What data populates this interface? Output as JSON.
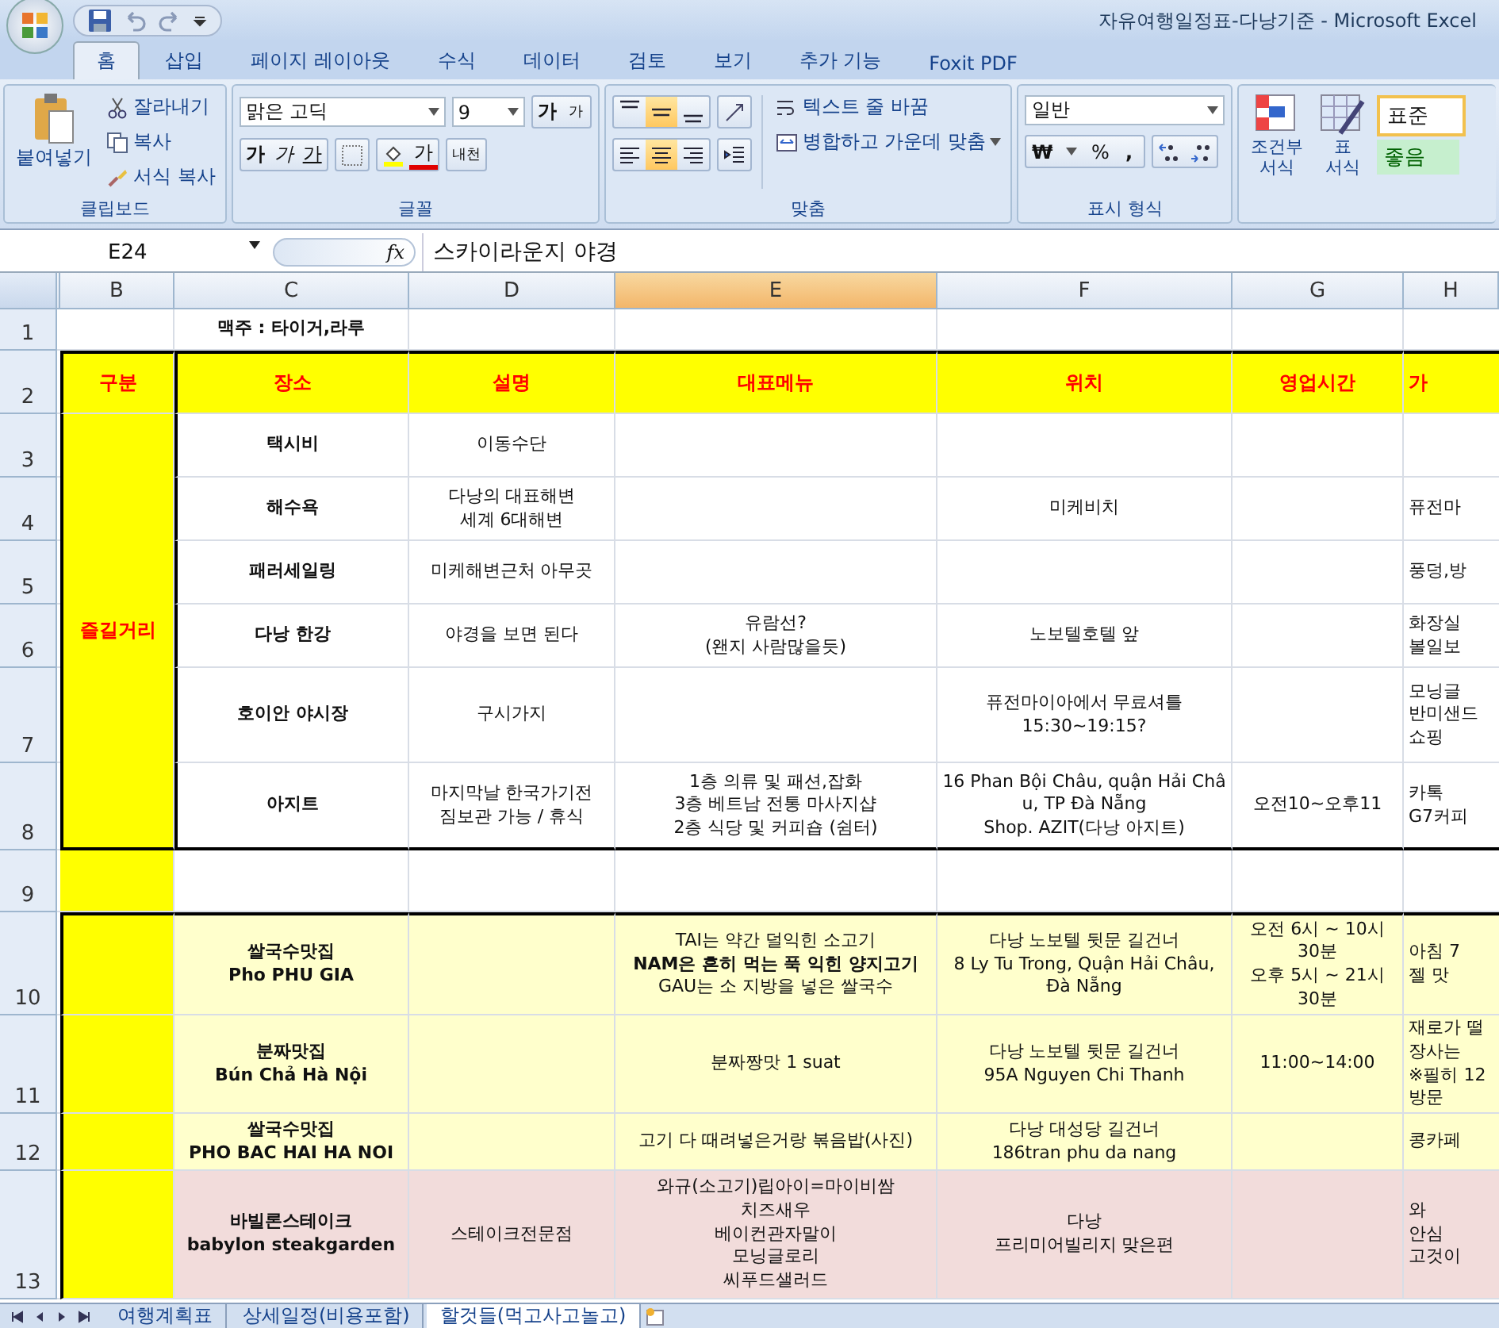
{
  "window": {
    "title": "자유여행일정표-다낭기준 - Microsoft Excel"
  },
  "tabs": [
    {
      "label": "홈",
      "selected": true
    },
    {
      "label": "삽입",
      "selected": false
    },
    {
      "label": "페이지 레이아웃",
      "selected": false
    },
    {
      "label": "수식",
      "selected": false
    },
    {
      "label": "데이터",
      "selected": false
    },
    {
      "label": "검토",
      "selected": false
    },
    {
      "label": "보기",
      "selected": false
    },
    {
      "label": "추가 기능",
      "selected": false
    },
    {
      "label": "Foxit PDF",
      "selected": false
    }
  ],
  "clipboard": {
    "paste": "붙여넣기",
    "cut": "잘라내기",
    "copy": "복사",
    "format_painter": "서식 복사",
    "label": "클립보드"
  },
  "font": {
    "name": "맑은 고딕",
    "size": "9",
    "grow": "가",
    "shrink": "가",
    "bold": "가",
    "italic": "가",
    "underline": "가",
    "font_color": "가",
    "phonetic": "내천",
    "label": "글꼴"
  },
  "alignment": {
    "vertical": [
      {
        "kind": "top",
        "selected": false
      },
      {
        "kind": "middle",
        "selected": true
      },
      {
        "kind": "bottom",
        "selected": false
      }
    ],
    "horizontal": [
      {
        "kind": "left",
        "selected": false
      },
      {
        "kind": "center",
        "selected": true
      },
      {
        "kind": "right",
        "selected": false
      }
    ],
    "wrap": "텍스트 줄 바꿈",
    "merge": "병합하고 가운데 맞춤",
    "label": "맞춤"
  },
  "number": {
    "format": "일반",
    "currency": "₩",
    "percent": "%",
    "comma": ",",
    "label": "표시 형식"
  },
  "styles": {
    "conditional": "조건부\n서식",
    "table": "표\n서식",
    "normal": "표준",
    "good": "좋음"
  },
  "formula_bar": {
    "name_box": "E24",
    "function_label": "fx",
    "formula": "스카이라운지 야경"
  },
  "columns": [
    {
      "label": "B",
      "selected": false
    },
    {
      "label": "C",
      "selected": false
    },
    {
      "label": "D",
      "selected": false
    },
    {
      "label": "E",
      "selected": true
    },
    {
      "label": "F",
      "selected": false
    },
    {
      "label": "G",
      "selected": false
    },
    {
      "label": "H",
      "selected": false
    }
  ],
  "category": "즐길거리",
  "rows": [
    {
      "number": "1",
      "kind": "plain",
      "cells": [
        "",
        "맥주 : 타이거,라루",
        "",
        "",
        "",
        "",
        ""
      ]
    },
    {
      "number": "2",
      "kind": "header",
      "cells": [
        "구분",
        "장소",
        "설명",
        "대표메뉴",
        "위치",
        "영업시간",
        "가"
      ]
    },
    {
      "number": "3",
      "kind": "item",
      "cells": [
        "",
        "택시비",
        "이동수단",
        "",
        "",
        "",
        ""
      ]
    },
    {
      "number": "4",
      "kind": "item",
      "cells": [
        "",
        "해수욕",
        "다낭의 대표해변\n세계 6대해변",
        "",
        "미케비치",
        "",
        "퓨전마"
      ]
    },
    {
      "number": "5",
      "kind": "item",
      "cells": [
        "",
        "패러세일링",
        "미케해변근처 아무곳",
        "",
        "",
        "",
        "풍덩,방"
      ]
    },
    {
      "number": "6",
      "kind": "item",
      "cells": [
        "",
        "다낭 한강",
        "야경을 보면 된다",
        "유람선?\n(왠지 사람많을듯)",
        "노보텔호텔 앞",
        "",
        "화장실\n볼일보"
      ]
    },
    {
      "number": "7",
      "kind": "item",
      "cells": [
        "",
        "호이안 야시장",
        "구시가지",
        "",
        "퓨전마이아에서 무료셔틀\n15:30~19:15?",
        "",
        "모닝글\n반미샌드\n쇼핑"
      ]
    },
    {
      "number": "8",
      "kind": "item",
      "cells": [
        "",
        "아지트",
        "마지막날 한국가기전\n짐보관 가능 / 휴식",
        "1층 의류 및 패션,잡화\n3층 베트남 전통 마사지샵\n2층 식당 및 커피숍 (쉼터)",
        "16 Phan Bội Châu, quận Hải Châ\nu, TP Đà Nẵng\nShop. AZIT(다낭 아지트)",
        "오전10~오후11",
        "카톡\nG7커피"
      ]
    },
    {
      "number": "9",
      "kind": "spacer",
      "cells": [
        "",
        "",
        "",
        "",
        "",
        "",
        ""
      ]
    },
    {
      "number": "10",
      "kind": "food",
      "cells": [
        "",
        "쌀국수맛집\nPho PHU GIA",
        "",
        "TAI는 약간 덜익힌 소고기\n**NAM은 흔히 먹는 푹 익힌 양지고기**\nGAU는 소 지방을 넣은 쌀국수",
        "다낭 노보텔 뒷문 길건너\n8 Ly Tu Trong, Quận Hải Châu,\nĐà Nẵng",
        "오전 6시 ~ 10시\n30분\n오후 5시 ~ 21시\n30분",
        "아침 7\n젤 맛"
      ]
    },
    {
      "number": "11",
      "kind": "food",
      "cells": [
        "",
        "분짜맛집\nBún Chả Hà Nội",
        "",
        "분짜짱맛 1 suat",
        "다낭 노보텔 뒷문 길건너\n95A Nguyen Chi Thanh",
        "11:00~14:00",
        "재로가 떨\n장사는\n※필히 12\n방문"
      ]
    },
    {
      "number": "12",
      "kind": "food",
      "cells": [
        "",
        "쌀국수맛집\nPHO BAC HAI HA NOI",
        "",
        "고기 다 때려넣은거랑 볶음밥(사진)",
        "다낭 대성당 길건너\n186tran phu da nang",
        "",
        "콩카페"
      ]
    },
    {
      "number": "13",
      "kind": "pink",
      "cells": [
        "",
        "바빌론스테이크\nbabylon steakgarden",
        "스테이크전문점",
        "와규(소고기)립아이=마이비쌈\n치즈새우\n베이컨관자말이\n모닝글로리\n씨푸드샐러드",
        "다낭\n프리미어빌리지 맞은편",
        "",
        "와\n안심\n고것이"
      ]
    }
  ],
  "sheets": [
    {
      "label": "여행계획표",
      "selected": false
    },
    {
      "label": "상세일정(비용포함)",
      "selected": false
    },
    {
      "label": "할것들(먹고사고놀고)",
      "selected": true
    }
  ]
}
